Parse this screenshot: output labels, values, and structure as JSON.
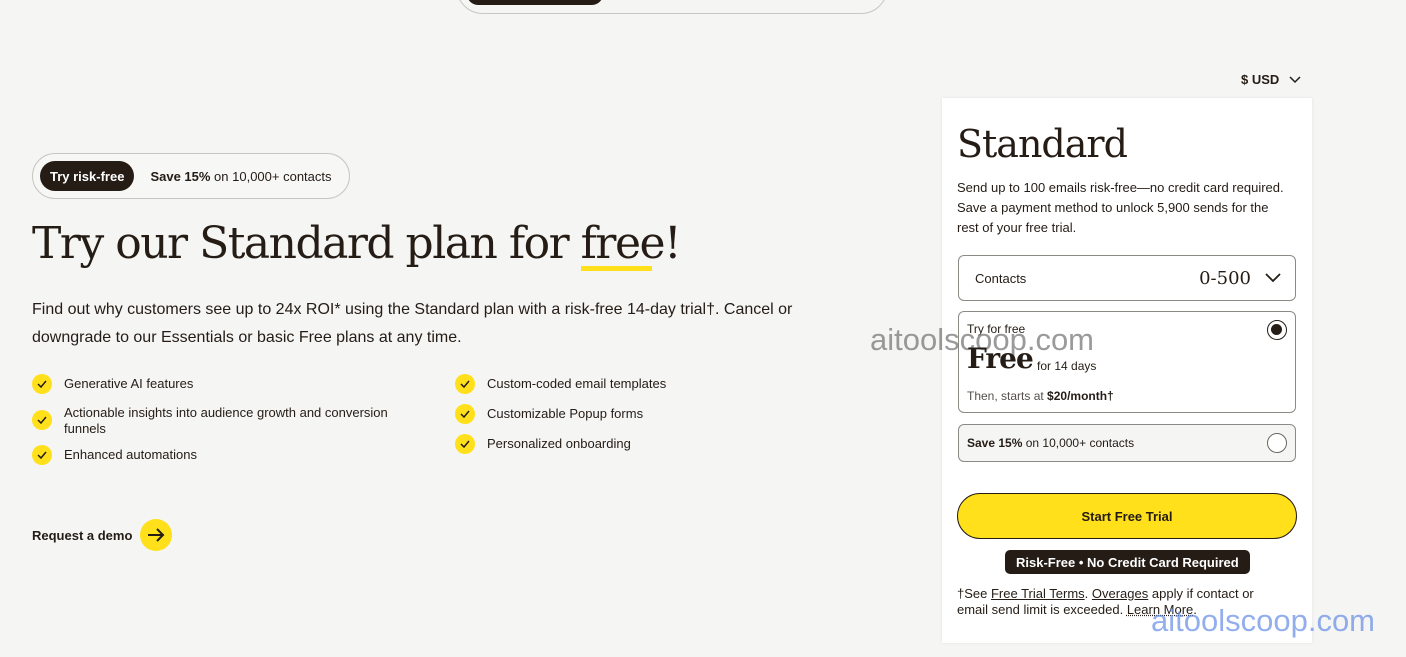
{
  "promo": {
    "badge": "Try risk-free",
    "save_bold": "Save 15%",
    "save_rest": " on 10,000+ contacts"
  },
  "hero": {
    "headline_pre": "Try our Standard plan for ",
    "headline_highlight": "free",
    "headline_post": "!",
    "description": "Find out why customers see up to 24x ROI* using the Standard plan with a risk-free 14-day trial†. Cancel or downgrade to our Essentials or basic Free plans at any time."
  },
  "features_left": [
    "Generative AI features",
    "Actionable insights into audience growth and conversion funnels",
    "Enhanced automations"
  ],
  "features_right": [
    "Custom-coded email templates",
    "Customizable Popup forms",
    "Personalized onboarding"
  ],
  "demo_label": "Request a demo",
  "currency": "$ USD",
  "card": {
    "title": "Standard",
    "description": "Send up to 100 emails risk-free—no credit card required. Save a payment method to unlock 5,900 sends for the rest of your free trial.",
    "contacts_label": "Contacts",
    "contacts_value": "0-500",
    "option1": {
      "small": "Try for free",
      "big": "Free",
      "days": "for 14 days",
      "then_prefix": "Then, starts at ",
      "then_price": "$20/month†",
      "selected": true
    },
    "option2": {
      "bold": "Save 15%",
      "rest": " on 10,000+ contacts",
      "selected": false
    },
    "cta": "Start Free Trial",
    "risk_badge": "Risk-Free • No Credit Card Required",
    "foot": {
      "pre": "†See ",
      "link1": "Free Trial Terms",
      "sep": ". ",
      "link2": "Overages",
      "mid": " apply if contact or email send limit is exceeded. ",
      "link3": "Learn More",
      "end": "."
    }
  },
  "watermark": "aitoolscoop.com",
  "colors": {
    "accent": "#ffe01b",
    "ink": "#241c15"
  }
}
